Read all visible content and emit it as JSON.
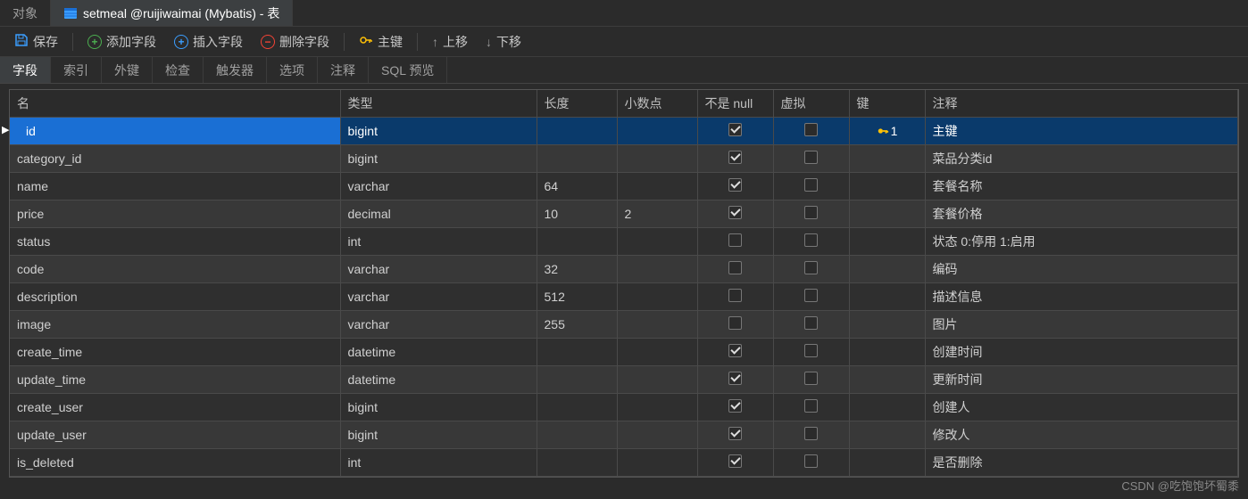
{
  "topTabs": {
    "objects": "对象",
    "activeTitle": "setmeal @ruijiwaimai (Mybatis) - 表"
  },
  "toolbar": {
    "save": "保存",
    "addField": "添加字段",
    "insertField": "插入字段",
    "deleteField": "删除字段",
    "primaryKey": "主键",
    "moveUp": "上移",
    "moveDown": "下移"
  },
  "subtabs": {
    "fields": "字段",
    "indexes": "索引",
    "foreignKeys": "外键",
    "checks": "检查",
    "triggers": "触发器",
    "options": "选项",
    "comment": "注释",
    "sqlPreview": "SQL 预览"
  },
  "columns": {
    "name": "名",
    "type": "类型",
    "length": "长度",
    "decimals": "小数点",
    "notNull": "不是 null",
    "virtual": "虚拟",
    "key": "键",
    "comment": "注释"
  },
  "rows": [
    {
      "name": "id",
      "type": "bigint",
      "length": "",
      "decimals": "",
      "notNull": true,
      "virtual": false,
      "key": "1",
      "comment": "主键",
      "selected": true
    },
    {
      "name": "category_id",
      "type": "bigint",
      "length": "",
      "decimals": "",
      "notNull": true,
      "virtual": false,
      "key": "",
      "comment": "菜品分类id"
    },
    {
      "name": "name",
      "type": "varchar",
      "length": "64",
      "decimals": "",
      "notNull": true,
      "virtual": false,
      "key": "",
      "comment": "套餐名称"
    },
    {
      "name": "price",
      "type": "decimal",
      "length": "10",
      "decimals": "2",
      "notNull": true,
      "virtual": false,
      "key": "",
      "comment": "套餐价格"
    },
    {
      "name": "status",
      "type": "int",
      "length": "",
      "decimals": "",
      "notNull": false,
      "virtual": false,
      "key": "",
      "comment": "状态 0:停用 1:启用"
    },
    {
      "name": "code",
      "type": "varchar",
      "length": "32",
      "decimals": "",
      "notNull": false,
      "virtual": false,
      "key": "",
      "comment": "编码"
    },
    {
      "name": "description",
      "type": "varchar",
      "length": "512",
      "decimals": "",
      "notNull": false,
      "virtual": false,
      "key": "",
      "comment": "描述信息"
    },
    {
      "name": "image",
      "type": "varchar",
      "length": "255",
      "decimals": "",
      "notNull": false,
      "virtual": false,
      "key": "",
      "comment": "图片"
    },
    {
      "name": "create_time",
      "type": "datetime",
      "length": "",
      "decimals": "",
      "notNull": true,
      "virtual": false,
      "key": "",
      "comment": "创建时间"
    },
    {
      "name": "update_time",
      "type": "datetime",
      "length": "",
      "decimals": "",
      "notNull": true,
      "virtual": false,
      "key": "",
      "comment": "更新时间"
    },
    {
      "name": "create_user",
      "type": "bigint",
      "length": "",
      "decimals": "",
      "notNull": true,
      "virtual": false,
      "key": "",
      "comment": "创建人"
    },
    {
      "name": "update_user",
      "type": "bigint",
      "length": "",
      "decimals": "",
      "notNull": true,
      "virtual": false,
      "key": "",
      "comment": "修改人"
    },
    {
      "name": "is_deleted",
      "type": "int",
      "length": "",
      "decimals": "",
      "notNull": true,
      "virtual": false,
      "key": "",
      "comment": "是否删除"
    }
  ],
  "watermark": "CSDN @吃饱饱坏蜀黍"
}
